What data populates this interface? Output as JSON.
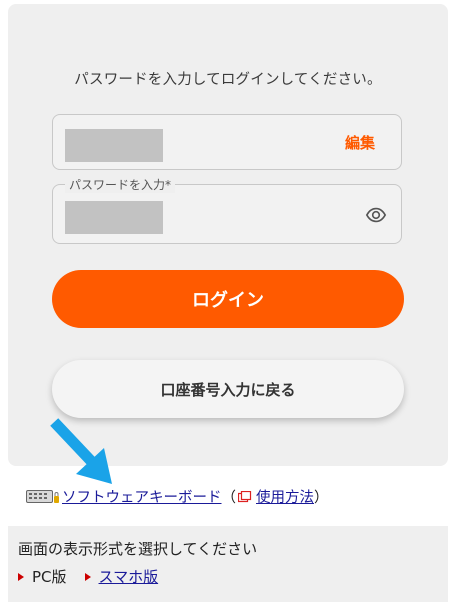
{
  "login": {
    "instruction": "パスワードを入力してログインしてください。",
    "edit_label": "編集",
    "password_label": "パスワードを入力*",
    "login_button": "ログイン",
    "back_button": "口座番号入力に戻る"
  },
  "software_keyboard": {
    "link_label": "ソフトウェアキーボード",
    "paren_open": "（",
    "usage_link": "使用方法",
    "paren_close": "）"
  },
  "display_mode": {
    "title": "画面の表示形式を選択してください",
    "options": [
      {
        "label": "PC版"
      },
      {
        "label": "スマホ版"
      }
    ]
  },
  "colors": {
    "accent": "#ff5a00",
    "arrow": "#1aa3e8",
    "link": "#1a1a99",
    "bullet": "#cc0000"
  },
  "icons": [
    "eye-icon",
    "keyboard-icon",
    "manual-icon",
    "pointer-arrow"
  ]
}
